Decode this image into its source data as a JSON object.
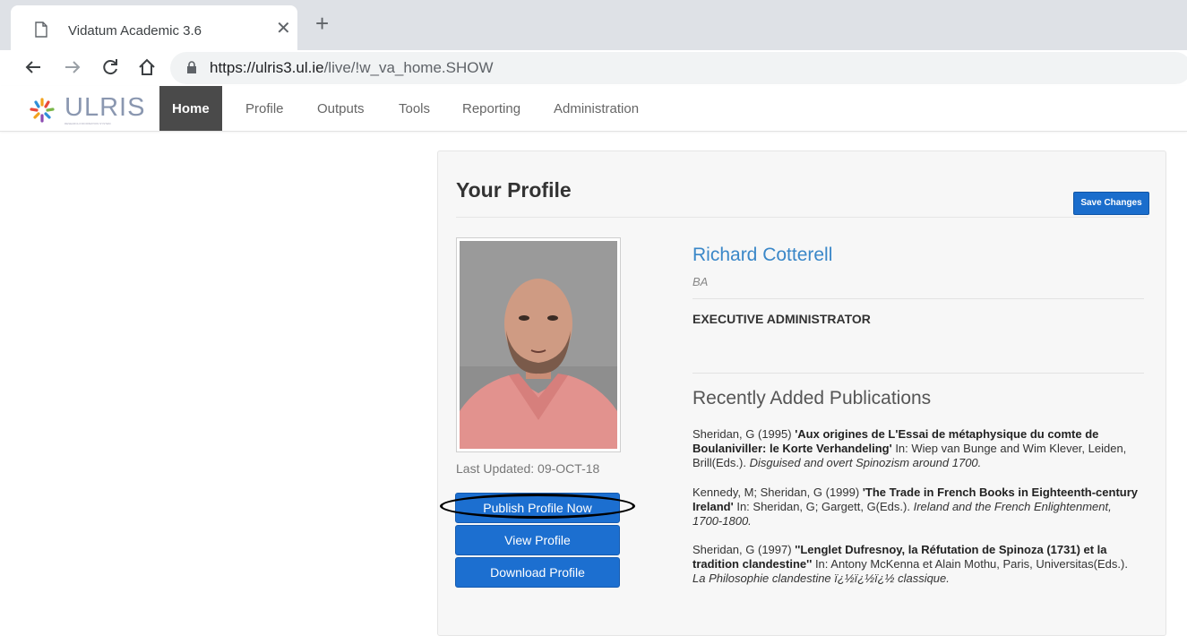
{
  "browser": {
    "tab_title": "Vidatum Academic 3.6",
    "url_host": "https://ulris3.ul.ie",
    "url_path": "/live/!w_va_home.SHOW"
  },
  "app": {
    "logo_text": "ULRIS",
    "logo_subtitle": "RESEARCH INFORMATION SYSTEM",
    "nav": [
      {
        "label": "Home",
        "active": true
      },
      {
        "label": "Profile"
      },
      {
        "label": "Outputs"
      },
      {
        "label": "Tools"
      },
      {
        "label": "Reporting"
      },
      {
        "label": "Administration"
      }
    ]
  },
  "profile": {
    "heading": "Your Profile",
    "save_label": "Save Changes",
    "name": "Richard Cotterell",
    "degree": "BA",
    "position": "EXECUTIVE ADMINISTRATOR",
    "last_updated": "Last Updated: 09-OCT-18",
    "buttons": {
      "publish": "Publish Profile Now",
      "view": "View Profile",
      "download": "Download Profile"
    },
    "publications_heading": "Recently Added Publications",
    "publications": [
      {
        "authors": "Sheridan, G (1995) ",
        "title": "'Aux origines de L'Essai de métaphysique du comte de Boulaniviller: le Korte Verhandeling'",
        "details": " In: Wiep van Bunge and Wim Klever, Leiden, Brill(Eds.). ",
        "source": "Disguised and overt Spinozism around 1700."
      },
      {
        "authors": "Kennedy, M; Sheridan, G (1999) ",
        "title": "'The Trade in French Books in Eighteenth-century Ireland'",
        "details": " In: Sheridan, G; Gargett, G(Eds.). ",
        "source": "Ireland and the French Enlightenment, 1700-1800."
      },
      {
        "authors": "Sheridan, G (1997) ",
        "title": "''Lenglet Dufresnoy, la Réfutation de Spinoza (1731) et la tradition clandestine''",
        "details": " In: Antony McKenna et Alain Mothu, Paris, Universitas(Eds.). ",
        "source": "La Philosophie clandestine ï¿½ï¿½ï¿½ classique."
      }
    ]
  },
  "colors": {
    "link": "#3a87c8",
    "primary_button": "#1c6fd0",
    "nav_active": "#4a4a4a"
  }
}
